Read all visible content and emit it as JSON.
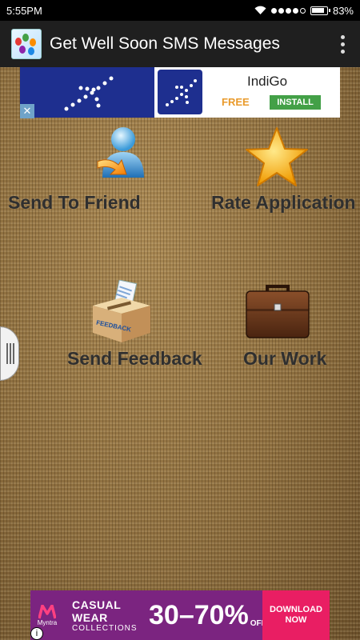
{
  "status_bar": {
    "time": "5:55PM",
    "battery": "83%"
  },
  "app_bar": {
    "title": "Get Well Soon SMS Messages"
  },
  "top_ad": {
    "brand": "IndiGo",
    "free_label": "FREE",
    "install_label": "INSTALL",
    "close_label": "✕"
  },
  "menu": {
    "send_to_friend": "Send To Friend",
    "rate_application": "Rate Application",
    "send_feedback": "Send Feedback",
    "our_work": "Our Work",
    "feedback_box_text": "FEEDBACK"
  },
  "bottom_ad": {
    "brand": "Myntra",
    "line1": "CASUAL WEAR",
    "line2": "COLLECTIONS",
    "offer": "30–70%",
    "offer_suffix": "OFF",
    "cta": "DOWNLOAD NOW",
    "info": "i"
  },
  "colors": {
    "status_bar_bg": "#000000",
    "app_bar_bg": "#1f1f1f",
    "burlap": "#8a6d3b",
    "indigo_blue": "#1e2f8f",
    "install_green": "#43a047",
    "myntra_purple": "#7b2480",
    "download_pink": "#e91e63"
  }
}
